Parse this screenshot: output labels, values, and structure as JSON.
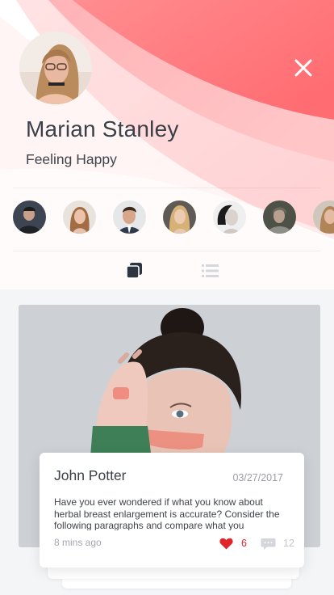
{
  "profile": {
    "name": "Marian Stanley",
    "status": "Feeling Happy",
    "avatar": "profile-photo"
  },
  "header": {
    "close_icon": "close-icon",
    "gradient_colors": [
      "#ff6f74",
      "#ffc9cb"
    ]
  },
  "friends": [
    {
      "avatar": "friend-avatar-1"
    },
    {
      "avatar": "friend-avatar-2"
    },
    {
      "avatar": "friend-avatar-3"
    },
    {
      "avatar": "friend-avatar-4"
    },
    {
      "avatar": "friend-avatar-5"
    },
    {
      "avatar": "friend-avatar-6"
    },
    {
      "avatar": "friend-avatar-7"
    }
  ],
  "view_tabs": [
    {
      "icon": "cards-icon",
      "active": true
    },
    {
      "icon": "list-icon",
      "active": false
    }
  ],
  "post": {
    "author": "John Potter",
    "date": "03/27/2017",
    "text": "Have you ever wondered if what you know about herbal breast enlargement is accurate? Consider the following paragraphs and compare what you",
    "time_ago": "8 mins ago",
    "likes": "6",
    "comments": "12",
    "like_color": "#e0252b"
  }
}
